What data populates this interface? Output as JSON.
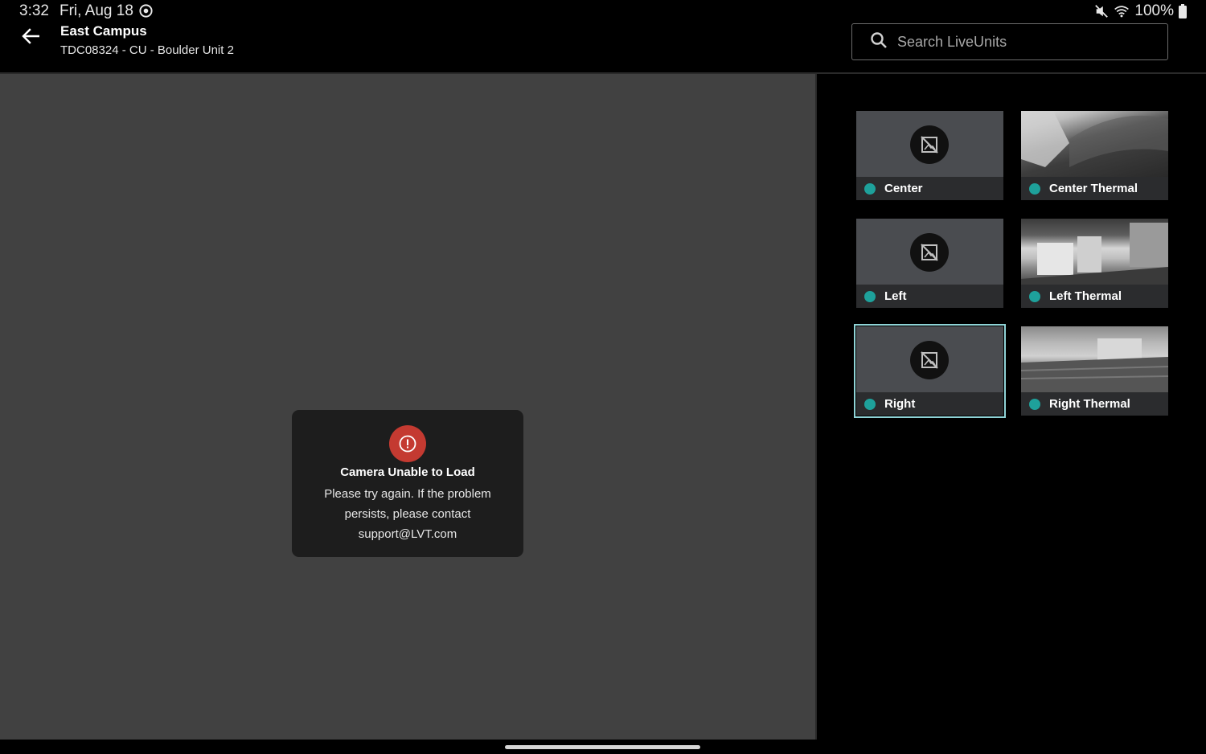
{
  "status_bar": {
    "time": "3:32",
    "date": "Fri, Aug 18",
    "battery": "100%",
    "icons": [
      "sync-icon",
      "mute-icon",
      "wifi-icon",
      "battery-icon"
    ]
  },
  "header": {
    "title": "East Campus",
    "subtitle": "TDC08324 - CU - Boulder Unit 2",
    "back_icon": "arrow-left-icon"
  },
  "search": {
    "placeholder": "Search LiveUnits",
    "value": "",
    "icon": "search-icon"
  },
  "error": {
    "icon": "alert-icon",
    "title": "Camera Unable to Load",
    "message": "Please try again. If the problem persists, please contact support@LVT.com"
  },
  "cameras": [
    {
      "label": "Center",
      "status": "online",
      "preview": "none"
    },
    {
      "label": "Center Thermal",
      "status": "online",
      "preview": "thermal"
    },
    {
      "label": "Left",
      "status": "online",
      "preview": "none"
    },
    {
      "label": "Left Thermal",
      "status": "online",
      "preview": "thermal"
    },
    {
      "label": "Right",
      "status": "online",
      "preview": "none",
      "selected": true
    },
    {
      "label": "Right Thermal",
      "status": "online",
      "preview": "thermal"
    }
  ],
  "colors": {
    "accent_status": "#1ea19b",
    "selected_outline": "#8fd3d6",
    "error": "#c43a31",
    "video_background": "#414141"
  }
}
